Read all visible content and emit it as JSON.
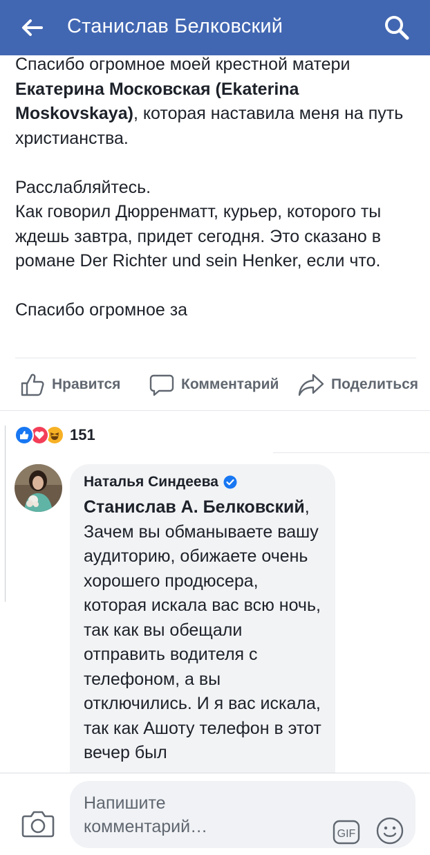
{
  "header": {
    "title": "Станислав Белковский"
  },
  "post": {
    "p1_a": "Спасибо огромное моей крестной матери",
    "p1_bold": "Екатерина Московская (Ekaterina Moskovskaya)",
    "p1_b": ", которая наставила меня на путь христианства.",
    "p2": "Расслабляйтесь.\nКак говорил Дюрренматт, курьер, которого ты ждешь завтра, придет сегодня. Это сказано в романе Der Richter und sein Henker, если что.",
    "p3": "Спасибо огромное за"
  },
  "actions": {
    "like": "Нравится",
    "comment": "Комментарий",
    "share": "Поделиться"
  },
  "reactions": {
    "count": "151",
    "types": [
      "like",
      "love",
      "haha"
    ]
  },
  "comment": {
    "author": "Наталья Синдеева",
    "verified": true,
    "mention": "Станислав А. Белковский",
    "text": "Зачем вы обманываете вашу аудиторию, обижаете очень хорошего продюсера, которая искала вас всю  ночь, так как вы обещали отправить водителя с телефоном, а вы отключились. И я вас искала, так как Ашоту телефон в этот вечер был"
  },
  "composer": {
    "placeholder": "Напишите комментарий…"
  },
  "colors": {
    "brand": "#4267b2",
    "like": "#1877f2",
    "love": "#f33e58",
    "haha": "#f7b125"
  }
}
